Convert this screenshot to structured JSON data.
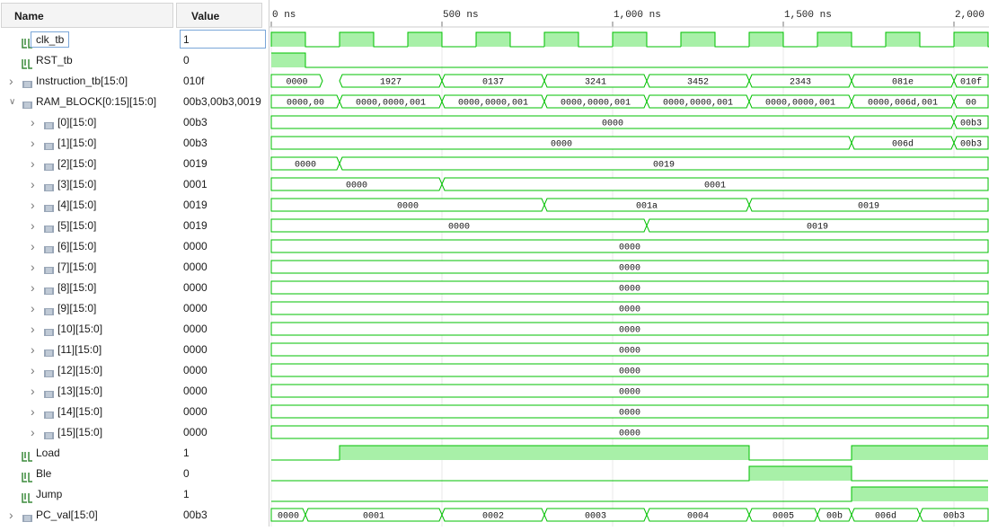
{
  "headers": {
    "name": "Name",
    "value": "Value"
  },
  "timeline": [
    {
      "label": "0 ns",
      "time": 0
    },
    {
      "label": "500 ns",
      "time": 500
    },
    {
      "label": "1,000 ns",
      "time": 1000
    },
    {
      "label": "1,500 ns",
      "time": 1500
    },
    {
      "label": "2,000",
      "time": 2000
    }
  ],
  "colors": {
    "wave": "#00c000",
    "wave_fill": "#a8f0a8",
    "grid": "#e8e8e8"
  },
  "signals": [
    {
      "name": "clk_tb",
      "value": "1",
      "icon": "bit-signal-icon",
      "indent": 0,
      "expand": "",
      "type": "clock",
      "selected": true
    },
    {
      "name": "RST_tb",
      "value": "0",
      "icon": "bit-signal-icon",
      "indent": 0,
      "expand": "",
      "type": "bit",
      "segments": [
        [
          0,
          100,
          1
        ],
        [
          100,
          2100,
          0
        ]
      ]
    },
    {
      "name": "Instruction_tb[15:0]",
      "value": "010f",
      "icon": "bus-signal-icon",
      "indent": 0,
      "expand": ">",
      "type": "bus",
      "segments": [
        [
          0,
          150,
          "0000"
        ],
        [
          200,
          500,
          "1927"
        ],
        [
          500,
          800,
          "0137"
        ],
        [
          800,
          1100,
          "3241"
        ],
        [
          1100,
          1400,
          "3452"
        ],
        [
          1400,
          1700,
          "2343"
        ],
        [
          1700,
          2000,
          "081e"
        ],
        [
          2000,
          2100,
          "010f"
        ]
      ]
    },
    {
      "name": "RAM_BLOCK[0:15][15:0]",
      "value": "00b3,00b3,0019",
      "icon": "bus-signal-icon",
      "indent": 0,
      "expand": "v",
      "type": "bus",
      "segments": [
        [
          0,
          200,
          "0000,00"
        ],
        [
          200,
          500,
          "0000,0000,001"
        ],
        [
          500,
          800,
          "0000,0000,001"
        ],
        [
          800,
          1100,
          "0000,0000,001"
        ],
        [
          1100,
          1400,
          "0000,0000,001"
        ],
        [
          1400,
          1700,
          "0000,0000,001"
        ],
        [
          1700,
          2000,
          "0000,006d,001"
        ],
        [
          2000,
          2100,
          "00"
        ]
      ]
    },
    {
      "name": "[0][15:0]",
      "value": "00b3",
      "icon": "bus-signal-icon",
      "indent": 1,
      "expand": ">",
      "type": "bus",
      "segments": [
        [
          0,
          2000,
          "0000"
        ],
        [
          2000,
          2100,
          "00b3"
        ]
      ]
    },
    {
      "name": "[1][15:0]",
      "value": "00b3",
      "icon": "bus-signal-icon",
      "indent": 1,
      "expand": ">",
      "type": "bus",
      "segments": [
        [
          0,
          1700,
          "0000"
        ],
        [
          1700,
          2000,
          "006d"
        ],
        [
          2000,
          2100,
          "00b3"
        ]
      ]
    },
    {
      "name": "[2][15:0]",
      "value": "0019",
      "icon": "bus-signal-icon",
      "indent": 1,
      "expand": ">",
      "type": "bus",
      "segments": [
        [
          0,
          200,
          "0000"
        ],
        [
          200,
          2100,
          "0019"
        ]
      ]
    },
    {
      "name": "[3][15:0]",
      "value": "0001",
      "icon": "bus-signal-icon",
      "indent": 1,
      "expand": ">",
      "type": "bus",
      "segments": [
        [
          0,
          500,
          "0000"
        ],
        [
          500,
          2100,
          "0001"
        ]
      ]
    },
    {
      "name": "[4][15:0]",
      "value": "0019",
      "icon": "bus-signal-icon",
      "indent": 1,
      "expand": ">",
      "type": "bus",
      "segments": [
        [
          0,
          800,
          "0000"
        ],
        [
          800,
          1400,
          "001a"
        ],
        [
          1400,
          2100,
          "0019"
        ]
      ]
    },
    {
      "name": "[5][15:0]",
      "value": "0019",
      "icon": "bus-signal-icon",
      "indent": 1,
      "expand": ">",
      "type": "bus",
      "segments": [
        [
          0,
          1100,
          "0000"
        ],
        [
          1100,
          2100,
          "0019"
        ]
      ]
    },
    {
      "name": "[6][15:0]",
      "value": "0000",
      "icon": "bus-signal-icon",
      "indent": 1,
      "expand": ">",
      "type": "bus",
      "segments": [
        [
          0,
          2100,
          "0000"
        ]
      ]
    },
    {
      "name": "[7][15:0]",
      "value": "0000",
      "icon": "bus-signal-icon",
      "indent": 1,
      "expand": ">",
      "type": "bus",
      "segments": [
        [
          0,
          2100,
          "0000"
        ]
      ]
    },
    {
      "name": "[8][15:0]",
      "value": "0000",
      "icon": "bus-signal-icon",
      "indent": 1,
      "expand": ">",
      "type": "bus",
      "segments": [
        [
          0,
          2100,
          "0000"
        ]
      ]
    },
    {
      "name": "[9][15:0]",
      "value": "0000",
      "icon": "bus-signal-icon",
      "indent": 1,
      "expand": ">",
      "type": "bus",
      "segments": [
        [
          0,
          2100,
          "0000"
        ]
      ]
    },
    {
      "name": "[10][15:0]",
      "value": "0000",
      "icon": "bus-signal-icon",
      "indent": 1,
      "expand": ">",
      "type": "bus",
      "segments": [
        [
          0,
          2100,
          "0000"
        ]
      ]
    },
    {
      "name": "[11][15:0]",
      "value": "0000",
      "icon": "bus-signal-icon",
      "indent": 1,
      "expand": ">",
      "type": "bus",
      "segments": [
        [
          0,
          2100,
          "0000"
        ]
      ]
    },
    {
      "name": "[12][15:0]",
      "value": "0000",
      "icon": "bus-signal-icon",
      "indent": 1,
      "expand": ">",
      "type": "bus",
      "segments": [
        [
          0,
          2100,
          "0000"
        ]
      ]
    },
    {
      "name": "[13][15:0]",
      "value": "0000",
      "icon": "bus-signal-icon",
      "indent": 1,
      "expand": ">",
      "type": "bus",
      "segments": [
        [
          0,
          2100,
          "0000"
        ]
      ]
    },
    {
      "name": "[14][15:0]",
      "value": "0000",
      "icon": "bus-signal-icon",
      "indent": 1,
      "expand": ">",
      "type": "bus",
      "segments": [
        [
          0,
          2100,
          "0000"
        ]
      ]
    },
    {
      "name": "[15][15:0]",
      "value": "0000",
      "icon": "bus-signal-icon",
      "indent": 1,
      "expand": ">",
      "type": "bus",
      "segments": [
        [
          0,
          2100,
          "0000"
        ]
      ]
    },
    {
      "name": "Load",
      "value": "1",
      "icon": "bit-signal-icon",
      "indent": 0,
      "expand": "",
      "type": "bit",
      "segments": [
        [
          0,
          200,
          0
        ],
        [
          200,
          1400,
          1
        ],
        [
          1400,
          1700,
          0
        ],
        [
          1700,
          2100,
          1
        ]
      ]
    },
    {
      "name": "Ble",
      "value": "0",
      "icon": "bit-signal-icon",
      "indent": 0,
      "expand": "",
      "type": "bit",
      "segments": [
        [
          0,
          1400,
          0
        ],
        [
          1400,
          1700,
          1
        ],
        [
          1700,
          2100,
          0
        ]
      ]
    },
    {
      "name": "Jump",
      "value": "1",
      "icon": "bit-signal-icon",
      "indent": 0,
      "expand": "",
      "type": "bit",
      "segments": [
        [
          0,
          1700,
          0
        ],
        [
          1700,
          2100,
          1
        ]
      ]
    },
    {
      "name": "PC_val[15:0]",
      "value": "00b3",
      "icon": "bus-signal-icon",
      "indent": 0,
      "expand": ">",
      "type": "bus",
      "segments": [
        [
          0,
          100,
          "0000"
        ],
        [
          100,
          500,
          "0001"
        ],
        [
          500,
          800,
          "0002"
        ],
        [
          800,
          1100,
          "0003"
        ],
        [
          1100,
          1400,
          "0004"
        ],
        [
          1400,
          1600,
          "0005"
        ],
        [
          1600,
          1700,
          "00b"
        ],
        [
          1700,
          1900,
          "006d"
        ],
        [
          1900,
          2100,
          "00b3"
        ]
      ]
    }
  ]
}
